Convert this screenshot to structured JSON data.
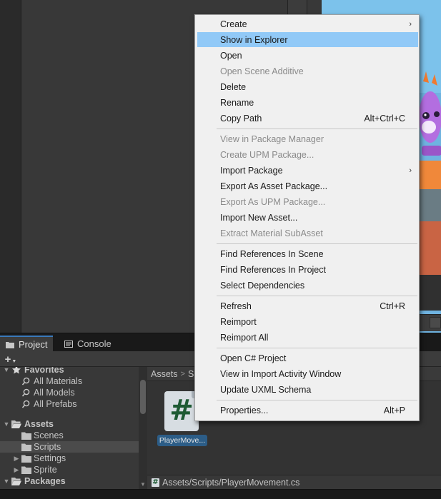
{
  "tabs": [
    {
      "label": "Project",
      "icon": "folder-icon",
      "active": true
    },
    {
      "label": "Console",
      "icon": "console-icon",
      "active": false
    }
  ],
  "toolbar": {
    "add_label": "+"
  },
  "tree": [
    {
      "label": "Favorites",
      "icon": "star-icon",
      "depth": 0,
      "arrow": "expanded",
      "bold": true,
      "selected": false
    },
    {
      "label": "All Materials",
      "icon": "search-icon",
      "depth": 1,
      "arrow": "none",
      "bold": false,
      "selected": false
    },
    {
      "label": "All Models",
      "icon": "search-icon",
      "depth": 1,
      "arrow": "none",
      "bold": false,
      "selected": false
    },
    {
      "label": "All Prefabs",
      "icon": "search-icon",
      "depth": 1,
      "arrow": "none",
      "bold": false,
      "selected": false
    },
    {
      "label": "Assets",
      "icon": "folder-open-icon",
      "depth": 0,
      "arrow": "expanded",
      "bold": true,
      "selected": false
    },
    {
      "label": "Scenes",
      "icon": "folder-icon",
      "depth": 1,
      "arrow": "none",
      "bold": false,
      "selected": false
    },
    {
      "label": "Scripts",
      "icon": "folder-icon",
      "depth": 1,
      "arrow": "none",
      "bold": false,
      "selected": true
    },
    {
      "label": "Settings",
      "icon": "folder-icon",
      "depth": 1,
      "arrow": "collapsed",
      "bold": false,
      "selected": false
    },
    {
      "label": "Sprite",
      "icon": "folder-icon",
      "depth": 1,
      "arrow": "collapsed",
      "bold": false,
      "selected": false
    },
    {
      "label": "Packages",
      "icon": "folder-open-icon",
      "depth": 0,
      "arrow": "expanded",
      "bold": true,
      "selected": false
    }
  ],
  "breadcrumb": {
    "root": "Assets",
    "separator": ">",
    "current": "S"
  },
  "asset": {
    "name": "PlayerMove...",
    "glyph": "#"
  },
  "path_bar": {
    "path": "Assets/Scripts/PlayerMovement.cs",
    "glyph": "#"
  },
  "context_menu": {
    "groups": [
      [
        {
          "label": "Create",
          "shortcut": "",
          "submenu": true,
          "disabled": false,
          "highlighted": false
        },
        {
          "label": "Show in Explorer",
          "shortcut": "",
          "submenu": false,
          "disabled": false,
          "highlighted": true
        },
        {
          "label": "Open",
          "shortcut": "",
          "submenu": false,
          "disabled": false,
          "highlighted": false
        },
        {
          "label": "Open Scene Additive",
          "shortcut": "",
          "submenu": false,
          "disabled": true,
          "highlighted": false
        },
        {
          "label": "Delete",
          "shortcut": "",
          "submenu": false,
          "disabled": false,
          "highlighted": false
        },
        {
          "label": "Rename",
          "shortcut": "",
          "submenu": false,
          "disabled": false,
          "highlighted": false
        },
        {
          "label": "Copy Path",
          "shortcut": "Alt+Ctrl+C",
          "submenu": false,
          "disabled": false,
          "highlighted": false
        }
      ],
      [
        {
          "label": "View in Package Manager",
          "shortcut": "",
          "submenu": false,
          "disabled": true,
          "highlighted": false
        },
        {
          "label": "Create UPM Package...",
          "shortcut": "",
          "submenu": false,
          "disabled": true,
          "highlighted": false
        },
        {
          "label": "Import Package",
          "shortcut": "",
          "submenu": true,
          "disabled": false,
          "highlighted": false
        },
        {
          "label": "Export As Asset Package...",
          "shortcut": "",
          "submenu": false,
          "disabled": false,
          "highlighted": false
        },
        {
          "label": "Export As UPM Package...",
          "shortcut": "",
          "submenu": false,
          "disabled": true,
          "highlighted": false
        },
        {
          "label": "Import New Asset...",
          "shortcut": "",
          "submenu": false,
          "disabled": false,
          "highlighted": false
        },
        {
          "label": "Extract Material SubAsset",
          "shortcut": "",
          "submenu": false,
          "disabled": true,
          "highlighted": false
        }
      ],
      [
        {
          "label": "Find References In Scene",
          "shortcut": "",
          "submenu": false,
          "disabled": false,
          "highlighted": false
        },
        {
          "label": "Find References In Project",
          "shortcut": "",
          "submenu": false,
          "disabled": false,
          "highlighted": false
        },
        {
          "label": "Select Dependencies",
          "shortcut": "",
          "submenu": false,
          "disabled": false,
          "highlighted": false
        }
      ],
      [
        {
          "label": "Refresh",
          "shortcut": "Ctrl+R",
          "submenu": false,
          "disabled": false,
          "highlighted": false
        },
        {
          "label": "Reimport",
          "shortcut": "",
          "submenu": false,
          "disabled": false,
          "highlighted": false
        },
        {
          "label": "Reimport All",
          "shortcut": "",
          "submenu": false,
          "disabled": false,
          "highlighted": false
        }
      ],
      [
        {
          "label": "Open C# Project",
          "shortcut": "",
          "submenu": false,
          "disabled": false,
          "highlighted": false
        },
        {
          "label": "View in Import Activity Window",
          "shortcut": "",
          "submenu": false,
          "disabled": false,
          "highlighted": false
        },
        {
          "label": "Update UXML Schema",
          "shortcut": "",
          "submenu": false,
          "disabled": false,
          "highlighted": false
        }
      ],
      [
        {
          "label": "Properties...",
          "shortcut": "Alt+P",
          "submenu": false,
          "disabled": false,
          "highlighted": false
        }
      ]
    ]
  },
  "colors": {
    "menu_highlight": "#91c9f7",
    "menu_disabled_text": "#8a8a8a",
    "selection_label": "#2c5d87",
    "active_tab_accent": "#3a79bb"
  }
}
